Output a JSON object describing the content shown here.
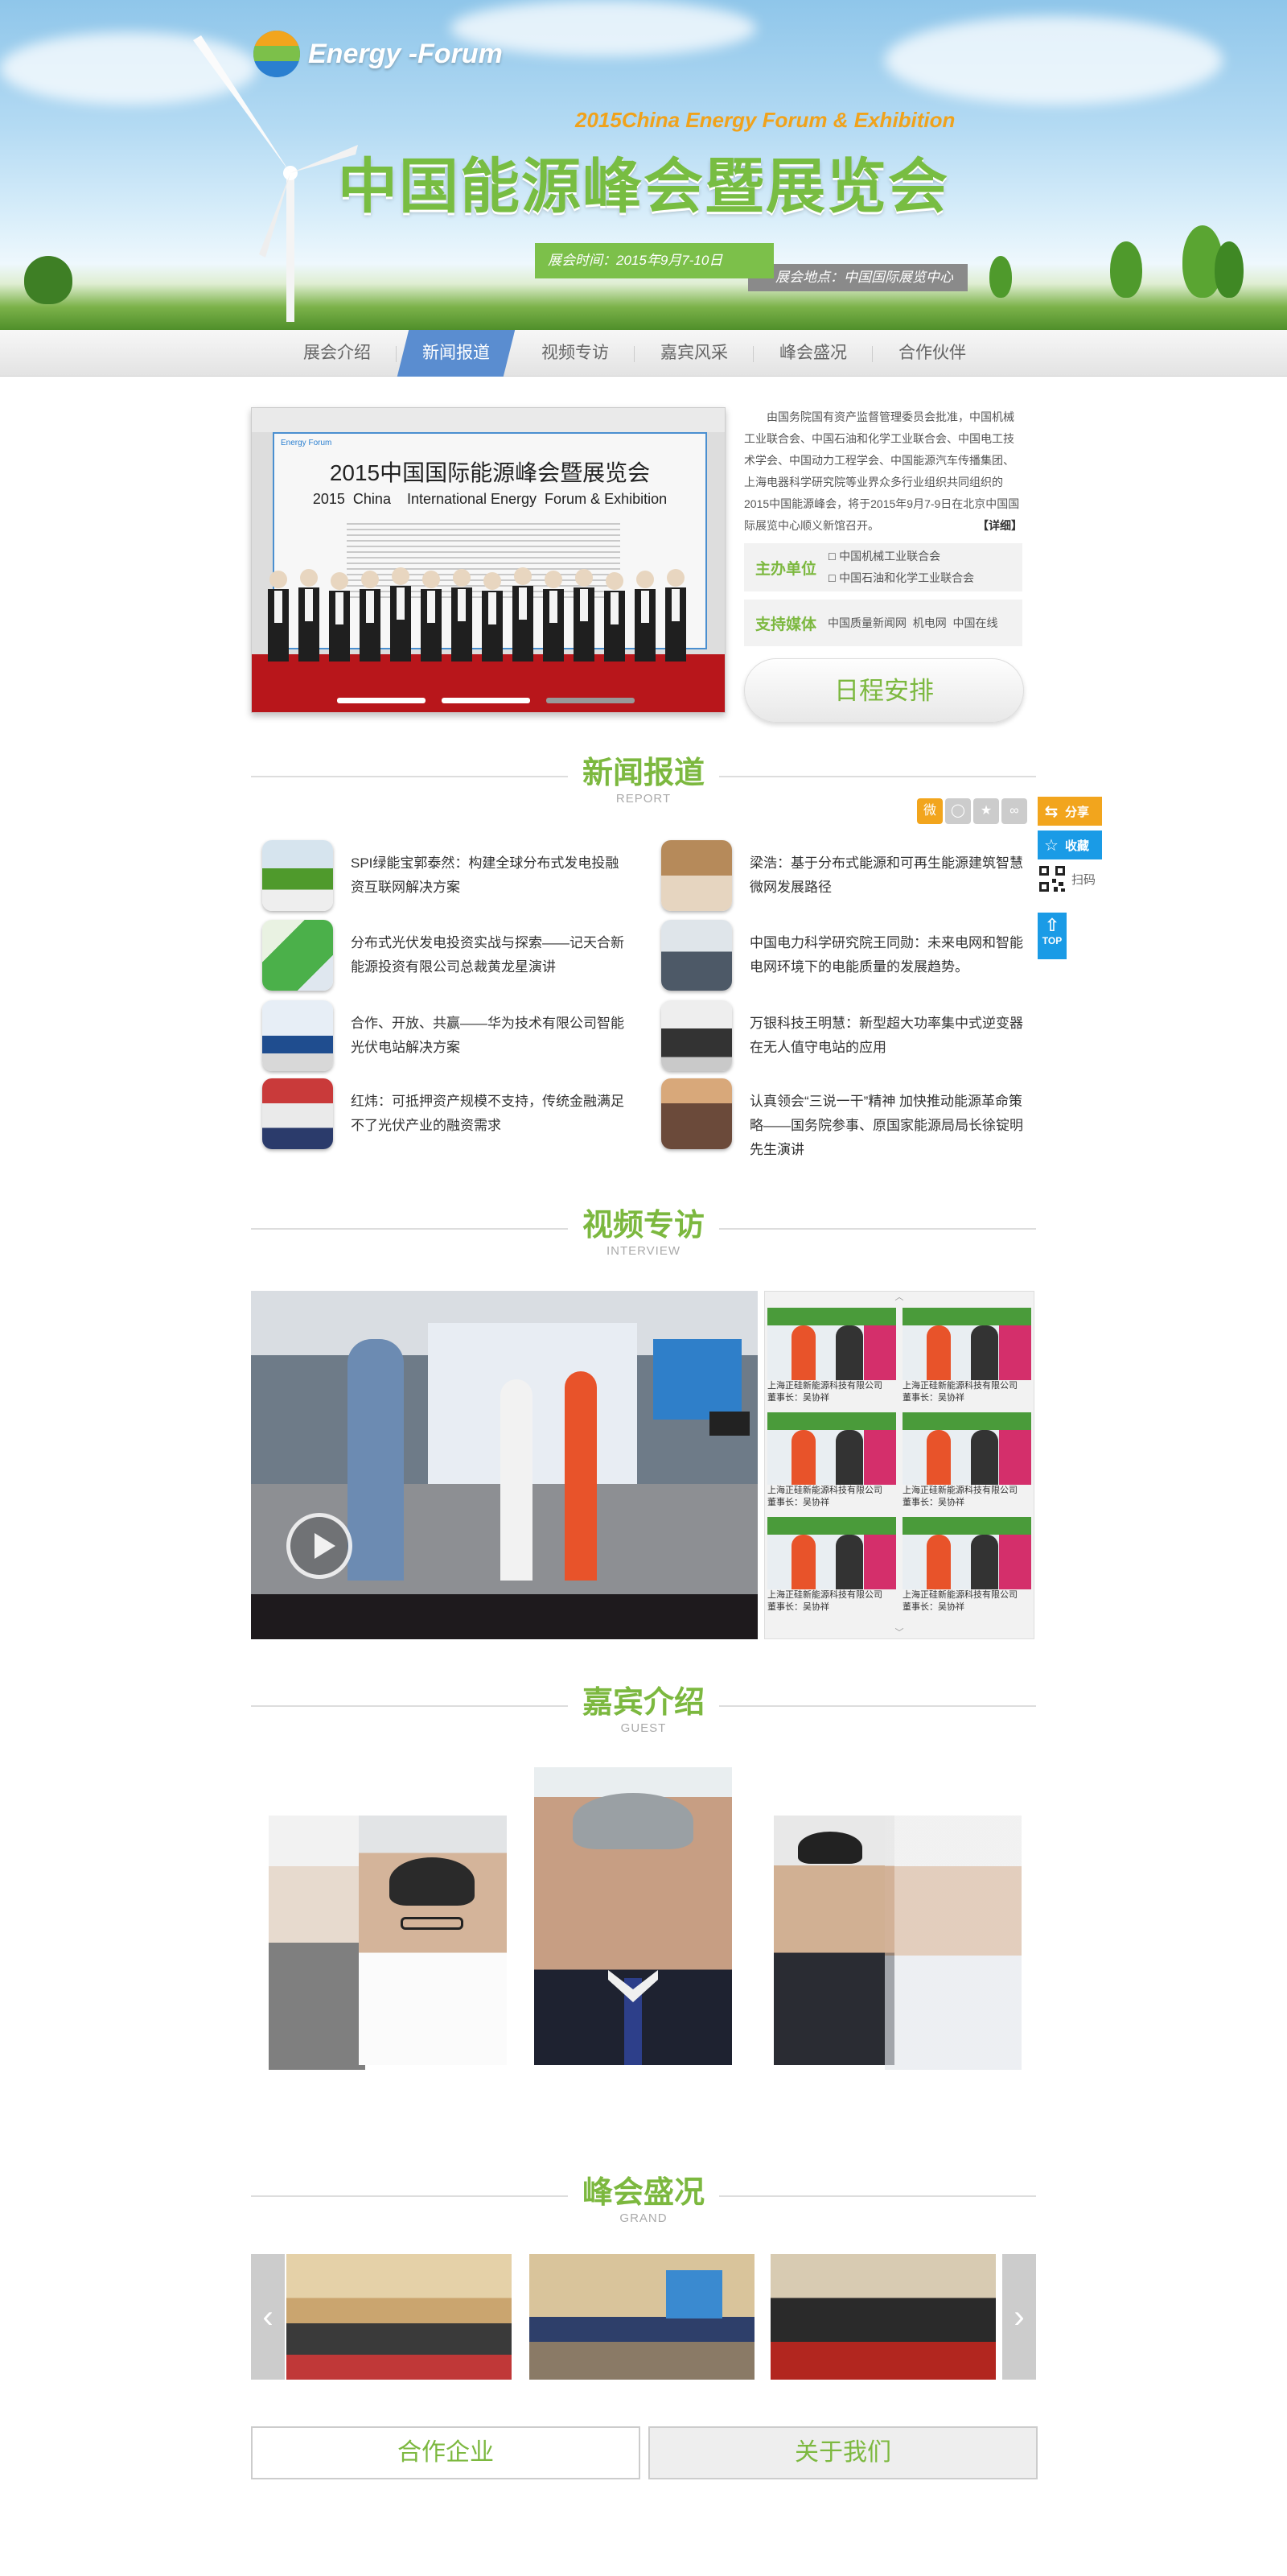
{
  "hero": {
    "logo_text": "Energy -Forum",
    "subtitle": "2015China Energy Forum & Exhibition",
    "title": "中国能源峰会暨展览会",
    "date": "展会时间：2015年9月7-10日",
    "venue": "展会地点：中国国际展览中心"
  },
  "nav": {
    "items": [
      {
        "label": "展会介绍"
      },
      {
        "label": "新闻报道"
      },
      {
        "label": "视频专访"
      },
      {
        "label": "嘉宾风采"
      },
      {
        "label": "峰会盛况"
      },
      {
        "label": "合作伙伴"
      }
    ],
    "active_index": 1
  },
  "banner": {
    "board_title": "2015中国国际能源峰会暨展览会",
    "board_subtitle": "2015  China    International Energy  Forum & Exhibition",
    "board_logo": "Energy Forum"
  },
  "intro": {
    "text": "由国务院国有资产监督管理委员会批准，中国机械工业联合会、中国石油和化学工业联合会、中国电工技术学会、中国动力工程学会、中国能源汽车传播集团、上海电器科学研究院等业界众多行业组织共同组织的2015中国能源峰会，将于2015年9月7-9日在北京中国国际展览中心顺义新馆召开。",
    "more": "【详细】",
    "host_label": "主办单位",
    "hosts": [
      "中国机械工业联合会",
      "中国石油和化学工业联合会"
    ],
    "media_label": "支持媒体",
    "media": "中国质量新闻网  机电网  中国在线",
    "schedule_button": "日程安排"
  },
  "sections": {
    "news": {
      "cn": "新闻报道",
      "en": "REPORT"
    },
    "interview": {
      "cn": "视频专访",
      "en": "INTERVIEW"
    },
    "guest": {
      "cn": "嘉宾介绍",
      "en": "GUEST"
    },
    "grand": {
      "cn": "峰会盛况",
      "en": "GRAND"
    }
  },
  "side_tools": {
    "share": "分享",
    "favorite": "收藏",
    "scan": "扫码",
    "top": "TOP"
  },
  "news": [
    {
      "title": "SPI绿能宝郭泰然：构建全球分布式发电投融资互联网解决方案"
    },
    {
      "title": "梁浩：基于分布式能源和可再生能源建筑智慧微网发展路径"
    },
    {
      "title": "分布式光伏发电投资实战与探索——记天合新能源投资有限公司总裁黄龙星演讲"
    },
    {
      "title": "中国电力科学研究院王同勋：未来电网和智能电网环境下的电能质量的发展趋势。"
    },
    {
      "title": "合作、开放、共赢——华为技术有限公司智能光伏电站解决方案"
    },
    {
      "title": "万银科技王明慧：新型超大功率集中式逆变器在无人值守电站的应用"
    },
    {
      "title": "红炜：可抵押资产规模不支持，传统金融满足不了光伏产业的融资需求"
    },
    {
      "title": "认真领会“三说一干”精神 加快推动能源革命策略——国务院参事、原国家能源局局长徐锭明先生演讲"
    }
  ],
  "video_list": [
    {
      "company": "上海正硅新能源科技有限公司",
      "person": "董事长：吴协祥"
    },
    {
      "company": "上海正硅新能源科技有限公司",
      "person": "董事长：吴协祥"
    },
    {
      "company": "上海正硅新能源科技有限公司",
      "person": "董事长：吴协祥"
    },
    {
      "company": "上海正硅新能源科技有限公司",
      "person": "董事长：吴协祥"
    },
    {
      "company": "上海正硅新能源科技有限公司",
      "person": "董事长：吴协祥"
    },
    {
      "company": "上海正硅新能源科技有限公司",
      "person": "董事长：吴协祥"
    }
  ],
  "footer_buttons": {
    "partners": "合作企业",
    "about": "关于我们"
  },
  "colors": {
    "brand_green": "#7cb83f",
    "nav_active": "#5a8dd0",
    "share_orange": "#f2a51d",
    "side_blue": "#1a9be6"
  }
}
